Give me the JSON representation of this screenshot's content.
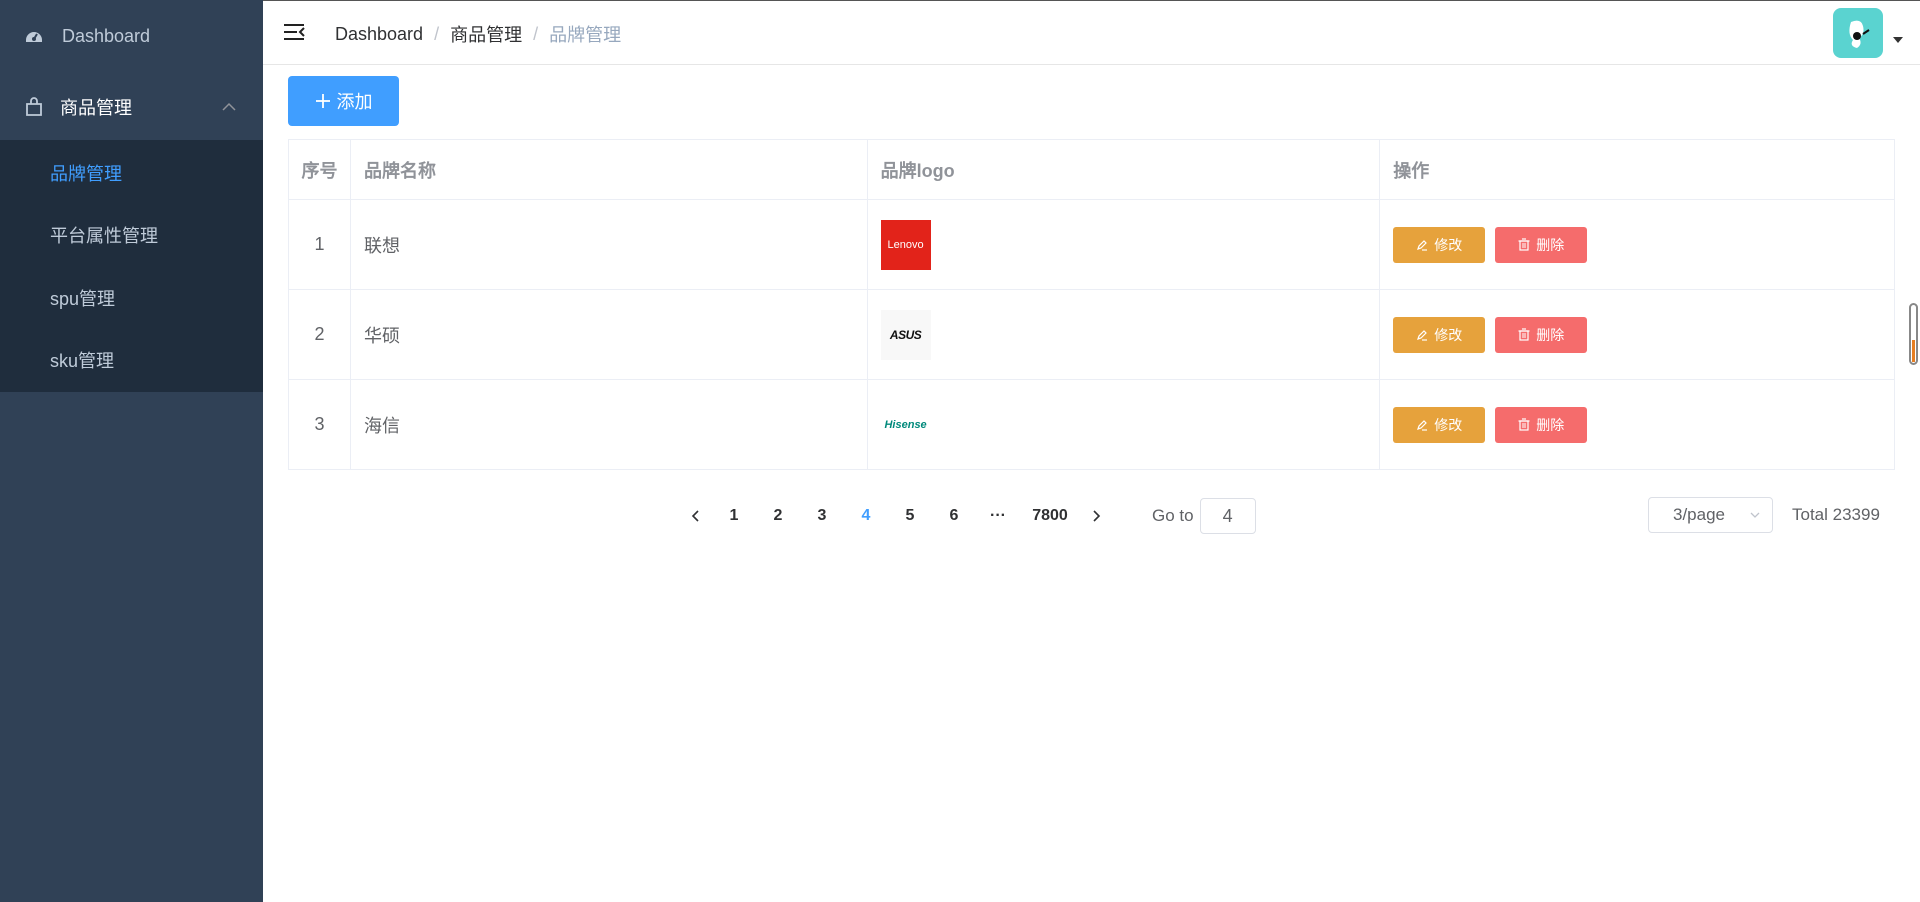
{
  "sidebar": {
    "dashboard_label": "Dashboard",
    "group_label": "商品管理",
    "items": [
      {
        "label": "品牌管理",
        "active": true
      },
      {
        "label": "平台属性管理",
        "active": false
      },
      {
        "label": "spu管理",
        "active": false
      },
      {
        "label": "sku管理",
        "active": false
      }
    ]
  },
  "breadcrumb": [
    "Dashboard",
    "商品管理",
    "品牌管理"
  ],
  "toolbar": {
    "add_label": "添加"
  },
  "table": {
    "headers": [
      "序号",
      "品牌名称",
      "品牌logo",
      "操作"
    ],
    "rows": [
      {
        "index": "1",
        "name": "联想",
        "logo": "Lenovo"
      },
      {
        "index": "2",
        "name": "华硕",
        "logo": "ASUS"
      },
      {
        "index": "3",
        "name": "海信",
        "logo": "Hisense"
      }
    ],
    "edit_label": "修改",
    "delete_label": "删除"
  },
  "pagination": {
    "pages": [
      "1",
      "2",
      "3",
      "4",
      "5",
      "6",
      "···",
      "7800"
    ],
    "current": "4",
    "goto_label": "Go to",
    "goto_value": "4",
    "page_size": "3/page",
    "total": "Total 23399"
  },
  "colors": {
    "sidebar_bg": "#304156",
    "submenu_bg": "#1f2d3d",
    "primary": "#409eff",
    "warning": "#e6a23c",
    "danger": "#f56c6c"
  }
}
